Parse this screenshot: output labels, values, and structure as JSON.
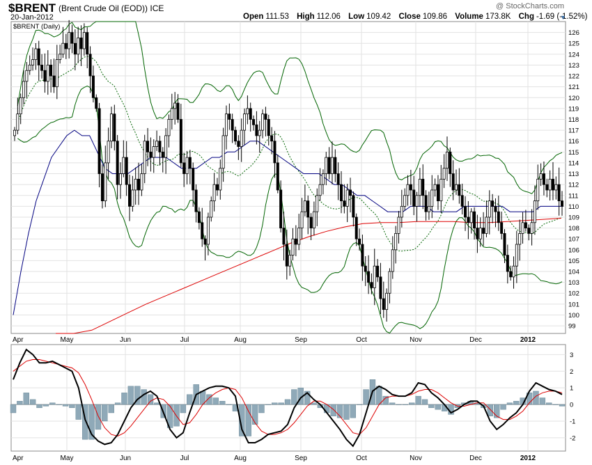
{
  "header": {
    "symbol": "$BRENT",
    "name": "(Brent Crude Oil (EOD)) ICE",
    "date": "20-Jan-2012",
    "credit": "@ StockCharts.com",
    "stats": [
      {
        "label": "Open",
        "value": "111.53"
      },
      {
        "label": "High",
        "value": "112.06"
      },
      {
        "label": "Low",
        "value": "109.42"
      },
      {
        "label": "Close",
        "value": "109.86"
      },
      {
        "label": "Volume",
        "value": "173.8K"
      },
      {
        "label": "Chg",
        "value": "-1.69 (-1.52%)"
      }
    ]
  },
  "colors": {
    "candle": "#000000",
    "sma_short": "#000080",
    "sma_long": "#dd0000",
    "bollinger": "#006400",
    "macd_line": "#000000",
    "signal_line": "#dd0000",
    "histogram": "#8fa9b8"
  },
  "chart_data": [
    {
      "type": "candlestick",
      "title": "$BRENT (Daily)",
      "x_labels": [
        "Apr",
        "May",
        "Jun",
        "Jul",
        "Aug",
        "Sep",
        "Oct",
        "Nov",
        "Dec",
        "2012"
      ],
      "ylim": [
        98.3,
        127.0
      ],
      "yticks": [
        99,
        100,
        101,
        102,
        103,
        104,
        105,
        106,
        107,
        108,
        109,
        110,
        111,
        112,
        113,
        114,
        115,
        116,
        117,
        118,
        119,
        120,
        121,
        122,
        123,
        124,
        125,
        126
      ],
      "closes": [
        117.0,
        118.5,
        120.0,
        121.5,
        122.5,
        123.0,
        123.5,
        124.5,
        123.0,
        122.5,
        121.5,
        123.0,
        122.0,
        121.0,
        123.5,
        124.0,
        125.0,
        124.5,
        126.0,
        125.0,
        124.0,
        125.5,
        124.5,
        126.0,
        124.0,
        122.0,
        120.0,
        119.0,
        113.0,
        110.5,
        114.0,
        116.0,
        118.5,
        116.0,
        112.0,
        113.0,
        114.5,
        112.0,
        110.0,
        111.5,
        112.5,
        111.5,
        113.0,
        116.0,
        115.0,
        114.5,
        115.5,
        116.0,
        115.0,
        114.5,
        116.5,
        118.0,
        119.0,
        119.5,
        118.0,
        114.0,
        113.0,
        114.5,
        113.5,
        111.5,
        109.5,
        108.5,
        107.0,
        106.5,
        109.0,
        110.5,
        112.0,
        111.5,
        113.5,
        116.5,
        118.5,
        118.0,
        117.0,
        116.0,
        115.5,
        117.0,
        118.5,
        119.0,
        118.0,
        117.5,
        116.5,
        117.0,
        118.5,
        118.0,
        116.5,
        116.0,
        114.0,
        111.5,
        108.0,
        106.5,
        104.5,
        105.5,
        107.0,
        106.5,
        108.0,
        109.5,
        110.5,
        109.0,
        108.0,
        109.5,
        111.0,
        112.0,
        113.0,
        114.5,
        113.0,
        114.5,
        113.0,
        112.0,
        110.5,
        110.0,
        111.5,
        111.0,
        109.0,
        107.0,
        106.5,
        104.5,
        104.0,
        103.0,
        102.5,
        104.5,
        103.5,
        101.5,
        100.5,
        102.0,
        104.0,
        106.0,
        107.5,
        109.0,
        110.0,
        111.0,
        112.0,
        111.5,
        110.0,
        111.0,
        112.5,
        111.0,
        109.5,
        110.0,
        111.5,
        112.0,
        110.5,
        112.5,
        113.5,
        115.0,
        113.0,
        111.5,
        112.0,
        111.0,
        110.0,
        109.0,
        108.5,
        109.5,
        108.0,
        107.0,
        108.0,
        107.5,
        109.0,
        110.5,
        110.0,
        109.5,
        108.5,
        107.5,
        105.5,
        104.0,
        103.5,
        104.5,
        106.5,
        107.5,
        108.5,
        108.0,
        107.5,
        108.5,
        110.5,
        112.5,
        113.0,
        112.0,
        111.5,
        112.5,
        111.5,
        112.0,
        110.5,
        110.0
      ],
      "sma_short": [
        100.0,
        104.0,
        107.5,
        110.5,
        112.5,
        114.5,
        115.5,
        116.5,
        117.0,
        116.5,
        116.5,
        115.0,
        113.5,
        113.0,
        113.0,
        113.0,
        113.5,
        114.0,
        114.5,
        114.5,
        114.5,
        114.0,
        113.5,
        113.5,
        113.5,
        114.0,
        114.5,
        114.5,
        115.0,
        115.0,
        115.5,
        116.0,
        116.0,
        115.5,
        115.0,
        114.5,
        114.0,
        113.5,
        113.0,
        113.0,
        113.0,
        112.5,
        112.0,
        112.0,
        111.5,
        111.0,
        111.0,
        110.5,
        110.0,
        109.5,
        109.5,
        109.5,
        110.0,
        110.0,
        110.0,
        109.5,
        109.5,
        109.5,
        109.5,
        110.0,
        110.0,
        110.0,
        110.0,
        110.0,
        110.0,
        109.5,
        109.5,
        109.5,
        109.5,
        110.0,
        110.0,
        110.0,
        110.0
      ],
      "sma_short_x": [
        0,
        2,
        4,
        6,
        8,
        10,
        12,
        14,
        16,
        18,
        20,
        22,
        24,
        26,
        28,
        30,
        32,
        34,
        36,
        38,
        40,
        42,
        44,
        46,
        48,
        50,
        52,
        54,
        56,
        58,
        60,
        62,
        64,
        66,
        68,
        70,
        72,
        74,
        76,
        78,
        80,
        82,
        84,
        86,
        88,
        90,
        92,
        94,
        96,
        98,
        100,
        102,
        104,
        106,
        108,
        110,
        112,
        114,
        116,
        118,
        120,
        122,
        124,
        126,
        128,
        130,
        132,
        134,
        136,
        138,
        140,
        142,
        144
      ],
      "sma_long": [
        97.0,
        97.8,
        98.6,
        99.4,
        100.2,
        101.0,
        101.7,
        102.4,
        103.1,
        103.8,
        104.5,
        105.2,
        105.9,
        106.6,
        107.2,
        107.7,
        108.1,
        108.4,
        108.5,
        108.5,
        108.6,
        108.6,
        108.6,
        108.5,
        108.5,
        108.6,
        108.7,
        108.8,
        108.9
      ]
    },
    {
      "type": "line",
      "title": "MACD",
      "ylim": [
        -2.8,
        3.6
      ],
      "yticks": [
        -2,
        -1,
        0,
        1,
        2,
        3
      ],
      "macd_line": [
        1.5,
        2.5,
        3.3,
        3.0,
        2.5,
        2.5,
        2.6,
        2.4,
        2.2,
        2.0,
        1.0,
        -0.9,
        -1.8,
        -2.2,
        -2.4,
        -2.3,
        -1.8,
        -1.0,
        -0.2,
        0.3,
        0.6,
        0.8,
        0.5,
        -0.5,
        -1.5,
        -2.0,
        -1.7,
        -0.5,
        0.6,
        0.8,
        1.0,
        1.1,
        1.1,
        1.0,
        0.5,
        -1.5,
        -2.3,
        -2.3,
        -2.1,
        -1.8,
        -1.7,
        -1.6,
        -1.2,
        -0.2,
        0.4,
        0.7,
        0.3,
        0.0,
        -0.5,
        -1.0,
        -1.5,
        -2.1,
        -2.5,
        -1.8,
        -0.5,
        0.8,
        1.1,
        0.9,
        0.6,
        0.5,
        0.5,
        0.7,
        1.3,
        1.2,
        0.7,
        0.4,
        0.0,
        -0.5,
        -0.3,
        0.0,
        0.2,
        0.2,
        -0.1,
        -1.0,
        -1.5,
        -1.2,
        -0.8,
        -0.5,
        0.0,
        0.8,
        1.3,
        1.1,
        0.9,
        0.8,
        0.6
      ],
      "signal_line": [
        2.0,
        2.3,
        2.6,
        2.7,
        2.7,
        2.6,
        2.5,
        2.4,
        2.3,
        2.2,
        1.9,
        1.2,
        0.3,
        -0.7,
        -1.4,
        -1.8,
        -1.9,
        -1.7,
        -1.3,
        -0.8,
        -0.3,
        0.2,
        0.4,
        0.3,
        -0.1,
        -0.7,
        -1.2,
        -1.1,
        -0.6,
        0.0,
        0.4,
        0.7,
        0.9,
        1.0,
        0.9,
        0.4,
        -0.4,
        -1.1,
        -1.6,
        -1.8,
        -1.8,
        -1.7,
        -1.5,
        -1.1,
        -0.6,
        -0.1,
        0.2,
        0.2,
        0.0,
        -0.3,
        -0.7,
        -1.2,
        -1.7,
        -1.8,
        -1.4,
        -0.7,
        0.0,
        0.4,
        0.5,
        0.5,
        0.5,
        0.6,
        0.8,
        0.9,
        0.9,
        0.7,
        0.4,
        0.1,
        -0.1,
        -0.1,
        0.0,
        0.1,
        0.1,
        -0.3,
        -0.7,
        -0.9,
        -0.9,
        -0.7,
        -0.4,
        0.1,
        0.5,
        0.7,
        0.8,
        0.8,
        0.7
      ],
      "histogram": [
        -0.5,
        0.2,
        0.7,
        0.3,
        -0.2,
        -0.1,
        0.1,
        0.0,
        -0.1,
        -0.2,
        -0.9,
        -2.1,
        -2.1,
        -1.5,
        -1.0,
        -0.5,
        0.1,
        0.7,
        1.1,
        1.1,
        0.9,
        0.6,
        0.1,
        -0.8,
        -1.4,
        -1.3,
        -0.5,
        0.6,
        1.2,
        0.8,
        0.6,
        0.4,
        0.2,
        0.0,
        -0.4,
        -1.9,
        -1.9,
        -1.2,
        -0.5,
        0.0,
        0.1,
        0.1,
        0.3,
        0.9,
        1.0,
        0.8,
        0.1,
        -0.2,
        -0.5,
        -0.7,
        -0.8,
        -0.9,
        -0.8,
        0.0,
        0.9,
        1.5,
        1.1,
        0.5,
        0.1,
        0.0,
        0.0,
        0.1,
        0.5,
        0.3,
        -0.2,
        -0.3,
        -0.4,
        -0.6,
        -0.2,
        0.1,
        0.2,
        0.1,
        -0.2,
        -0.7,
        -0.8,
        -0.3,
        0.1,
        0.2,
        0.4,
        0.7,
        0.8,
        0.4,
        0.1,
        0.0,
        -0.1
      ]
    }
  ]
}
